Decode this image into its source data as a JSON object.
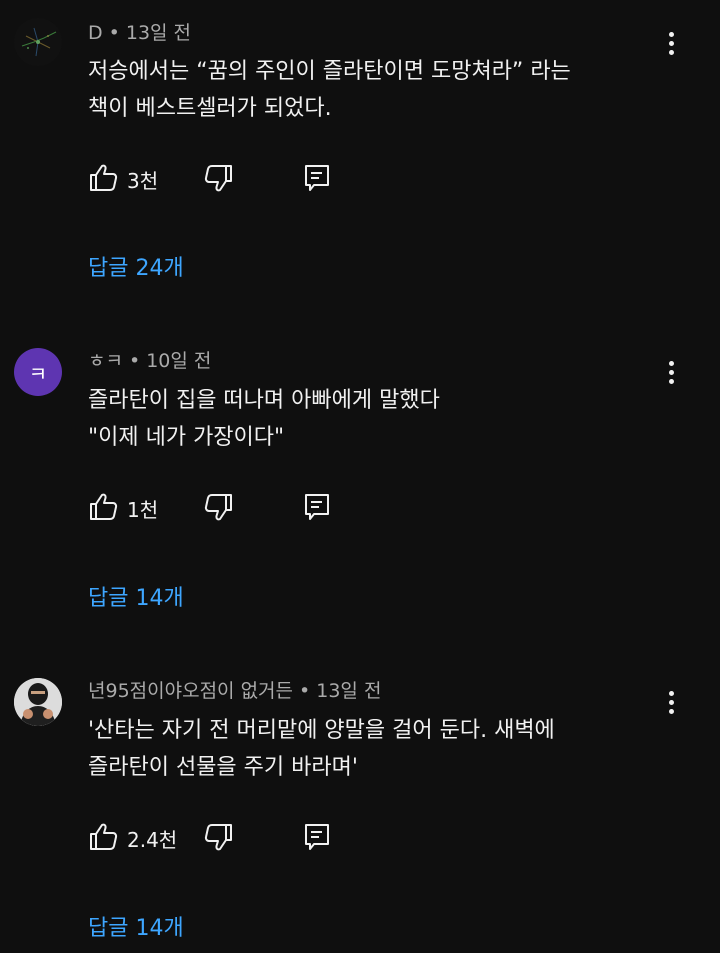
{
  "comments": [
    {
      "author": "D",
      "time": "13일 전",
      "lines": [
        "저승에서는 “꿈의 주인이 즐라탄이면 도망쳐라” 라는",
        "책이 베스트셀러가 되었다."
      ],
      "likes": "3천",
      "replies": "답글 24개"
    },
    {
      "author": "ㅎㅋ",
      "avatar_letter": "ㅋ",
      "time": "10일 전",
      "lines": [
        "즐라탄이 집을 떠나며 아빠에게 말했다",
        "\"이제 네가 가장이다\""
      ],
      "likes": "1천",
      "replies": "답글 14개"
    },
    {
      "author": "년95점이야오점이 없거든",
      "time": "13일 전",
      "lines": [
        "'산타는 자기 전 머리맡에 양말을 걸어 둔다. 새벽에",
        "즐라탄이 선물을 주기 바라며'"
      ],
      "likes": "2.4천",
      "replies": "답글 14개"
    }
  ],
  "icons": {
    "like": "thumbs-up-icon",
    "dislike": "thumbs-down-icon",
    "reply": "reply-comment-icon",
    "menu": "more-vertical-icon"
  },
  "colors": {
    "background": "#0f0f0f",
    "text": "#f1f1f1",
    "meta": "#aaaaaa",
    "link": "#3ea6ff",
    "avatar_purple": "#5e35b1"
  }
}
